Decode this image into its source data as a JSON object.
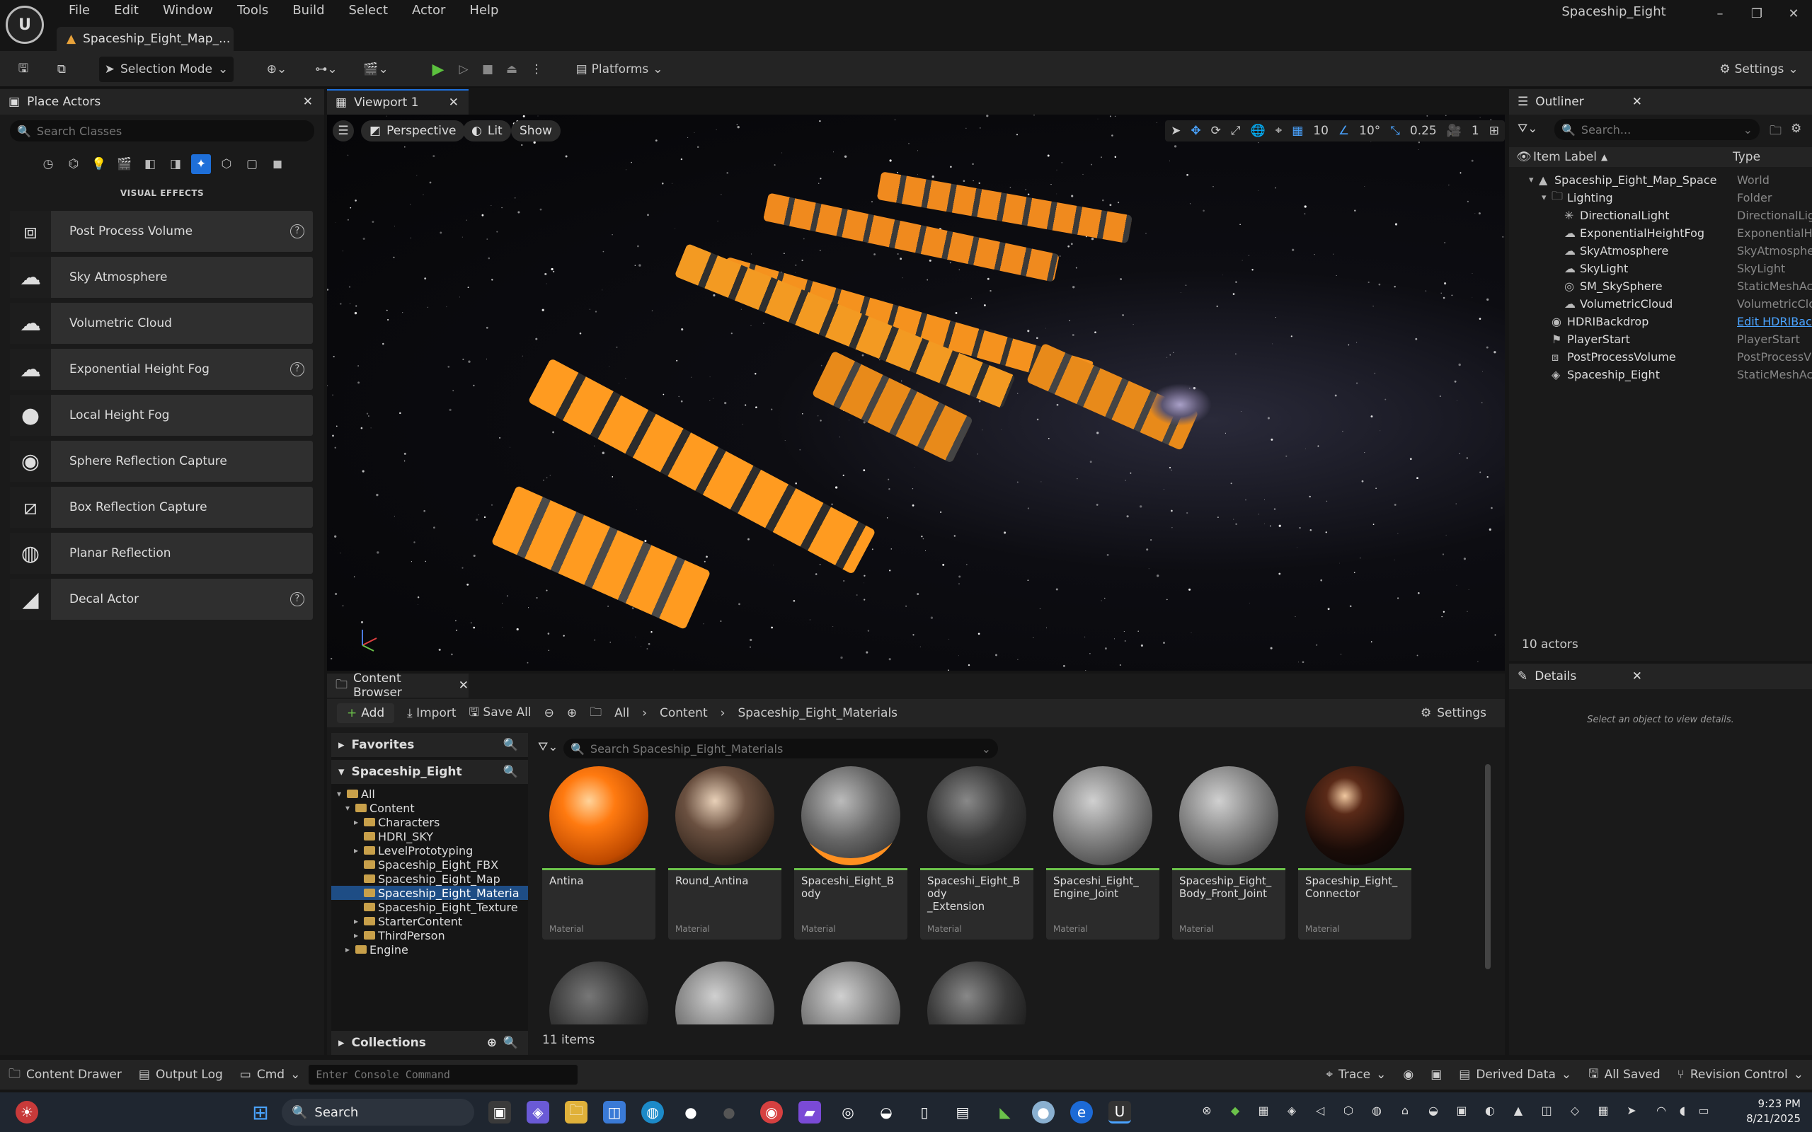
{
  "menu": [
    "File",
    "Edit",
    "Window",
    "Tools",
    "Build",
    "Select",
    "Actor",
    "Help"
  ],
  "doc_tab": "Spaceship_Eight_Map_...",
  "window_title": "Spaceship_Eight",
  "toolbar": {
    "selection_mode": "Selection Mode",
    "platforms": "Platforms",
    "settings": "Settings"
  },
  "place_actors": {
    "tab": "Place Actors",
    "search_placeholder": "Search Classes",
    "category": "VISUAL EFFECTS",
    "items": [
      {
        "label": "Post Process Volume",
        "help": true,
        "icon": "post-process-volume-icon"
      },
      {
        "label": "Sky Atmosphere",
        "help": false,
        "icon": "sky-atmosphere-icon"
      },
      {
        "label": "Volumetric Cloud",
        "help": false,
        "icon": "volumetric-cloud-icon"
      },
      {
        "label": "Exponential Height Fog",
        "help": true,
        "icon": "height-fog-icon"
      },
      {
        "label": "Local Height Fog",
        "help": false,
        "icon": "local-fog-icon"
      },
      {
        "label": "Sphere Reflection Capture",
        "help": false,
        "icon": "sphere-reflection-icon"
      },
      {
        "label": "Box Reflection Capture",
        "help": false,
        "icon": "box-reflection-icon"
      },
      {
        "label": "Planar Reflection",
        "help": false,
        "icon": "planar-reflection-icon"
      },
      {
        "label": "Decal Actor",
        "help": true,
        "icon": "decal-icon"
      }
    ]
  },
  "viewport": {
    "tab": "Viewport 1",
    "perspective": "Perspective",
    "lit": "Lit",
    "show": "Show",
    "grid_snap": "10",
    "rotation_snap": "10°",
    "scale_snap": "0.25",
    "camera_speed": "1"
  },
  "outliner": {
    "tab": "Outliner",
    "search_placeholder": "Search...",
    "col_label": "Item Label",
    "col_type": "Type",
    "rows": [
      {
        "label": "Spaceship_Eight_Map_Space",
        "type": "World",
        "indent": 0
      },
      {
        "label": "Lighting",
        "type": "Folder",
        "indent": 1
      },
      {
        "label": "DirectionalLight",
        "type": "DirectionalLig",
        "indent": 2
      },
      {
        "label": "ExponentialHeightFog",
        "type": "ExponentialH",
        "indent": 2
      },
      {
        "label": "SkyAtmosphere",
        "type": "SkyAtmosphe",
        "indent": 2
      },
      {
        "label": "SkyLight",
        "type": "SkyLight",
        "indent": 2
      },
      {
        "label": "SM_SkySphere",
        "type": "StaticMeshAc",
        "indent": 2
      },
      {
        "label": "VolumetricCloud",
        "type": "VolumetricClo",
        "indent": 2
      },
      {
        "label": "HDRIBackdrop",
        "type": "Edit HDRIBac",
        "indent": 1,
        "link": true
      },
      {
        "label": "PlayerStart",
        "type": "PlayerStart",
        "indent": 1
      },
      {
        "label": "PostProcessVolume",
        "type": "PostProcessV",
        "indent": 1
      },
      {
        "label": "Spaceship_Eight",
        "type": "StaticMeshAc",
        "indent": 1
      }
    ],
    "count": "10 actors"
  },
  "details": {
    "tab": "Details",
    "empty": "Select an object to view details."
  },
  "content_browser": {
    "tab": "Content Browser",
    "add": "Add",
    "import": "Import",
    "save_all": "Save All",
    "breadcrumb": [
      "All",
      "Content",
      "Spaceship_Eight_Materials"
    ],
    "settings": "Settings",
    "favorites": "Favorites",
    "project": "Spaceship_Eight",
    "tree": [
      {
        "label": "All",
        "indent": 0,
        "arrow": "▾"
      },
      {
        "label": "Content",
        "indent": 1,
        "arrow": "▾"
      },
      {
        "label": "Characters",
        "indent": 2,
        "arrow": "▸"
      },
      {
        "label": "HDRI_SKY",
        "indent": 2,
        "arrow": ""
      },
      {
        "label": "LevelPrototyping",
        "indent": 2,
        "arrow": "▸"
      },
      {
        "label": "Spaceship_Eight_FBX",
        "indent": 2,
        "arrow": ""
      },
      {
        "label": "Spaceship_Eight_Map",
        "indent": 2,
        "arrow": ""
      },
      {
        "label": "Spaceship_Eight_Materia",
        "indent": 2,
        "arrow": "",
        "selected": true
      },
      {
        "label": "Spaceship_Eight_Texture",
        "indent": 2,
        "arrow": ""
      },
      {
        "label": "StarterContent",
        "indent": 2,
        "arrow": "▸"
      },
      {
        "label": "ThirdPerson",
        "indent": 2,
        "arrow": "▸"
      },
      {
        "label": "Engine",
        "indent": 1,
        "arrow": "▸"
      }
    ],
    "collections": "Collections",
    "search_placeholder": "Search Spaceship_Eight_Materials",
    "assets": [
      {
        "name": "Antina",
        "type": "Material",
        "style": "orange"
      },
      {
        "name": "Round_Antina",
        "type": "Material",
        "style": "bronze"
      },
      {
        "name": "Spaceshi_Eight_Body",
        "type": "Material",
        "style": "greyorange"
      },
      {
        "name": "Spaceshi_Eight_Body\n_Extension",
        "type": "Material",
        "style": "darkcrack"
      },
      {
        "name": "Spaceshi_Eight_\nEngine_Joint",
        "type": "Material",
        "style": "grey"
      },
      {
        "name": "Spaceship_Eight_\nBody_Front_Joint",
        "type": "Material",
        "style": "grey"
      },
      {
        "name": "Spaceship_Eight_\nConnector",
        "type": "Material",
        "style": "black"
      },
      {
        "name": "",
        "type": "",
        "style": "darkgrey"
      },
      {
        "name": "",
        "type": "",
        "style": "grey"
      },
      {
        "name": "",
        "type": "",
        "style": "grey"
      },
      {
        "name": "",
        "type": "",
        "style": "darkorange"
      }
    ],
    "item_count": "11 items"
  },
  "statusbar": {
    "content_drawer": "Content Drawer",
    "output_log": "Output Log",
    "cmd": "Cmd",
    "console_placeholder": "Enter Console Command",
    "trace": "Trace",
    "derived_data": "Derived Data",
    "all_saved": "All Saved",
    "revision_control": "Revision Control"
  },
  "taskbar": {
    "search": "Search",
    "time": "9:23 PM",
    "date": "8/21/2025"
  }
}
